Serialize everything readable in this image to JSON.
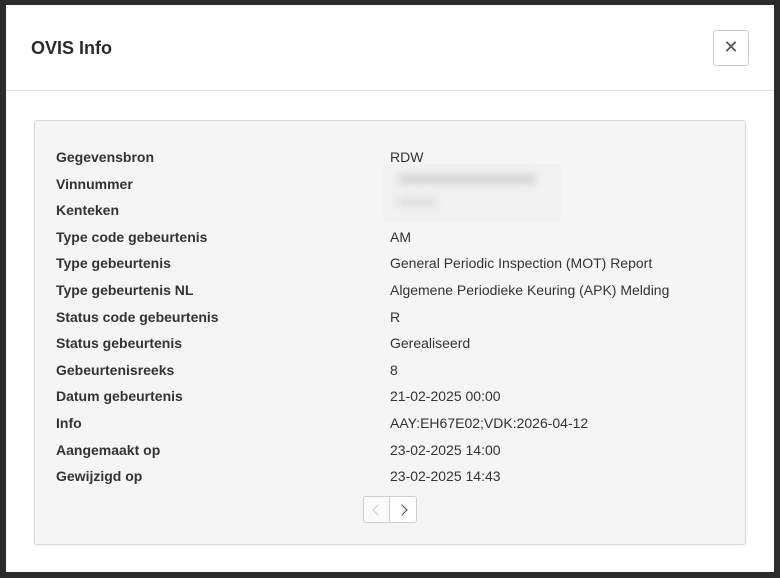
{
  "modal": {
    "title": "OVIS Info",
    "close_icon": "close-icon"
  },
  "info": {
    "rows": [
      {
        "label": "Gegevensbron",
        "value": "RDW"
      },
      {
        "label": "Vinnummer",
        "value": ""
      },
      {
        "label": "Kenteken",
        "value": ""
      },
      {
        "label": "Type code gebeurtenis",
        "value": "AM"
      },
      {
        "label": "Type gebeurtenis",
        "value": "General Periodic Inspection (MOT) Report"
      },
      {
        "label": "Type gebeurtenis NL",
        "value": "Algemene Periodieke Keuring (APK) Melding"
      },
      {
        "label": "Status code gebeurtenis",
        "value": "R"
      },
      {
        "label": "Status gebeurtenis",
        "value": "Gerealiseerd"
      },
      {
        "label": "Gebeurtenisreeks",
        "value": "8"
      },
      {
        "label": "Datum gebeurtenis",
        "value": "21-02-2025 00:00"
      },
      {
        "label": "Info",
        "value": "AAY:EH67E02;VDK:2026-04-12"
      },
      {
        "label": "Aangemaakt op",
        "value": "23-02-2025 14:00"
      },
      {
        "label": "Gewijzigd op",
        "value": "23-02-2025 14:43"
      }
    ]
  },
  "pager": {
    "prev_icon": "chevron-left-icon",
    "next_icon": "chevron-right-icon",
    "prev_disabled": true
  }
}
